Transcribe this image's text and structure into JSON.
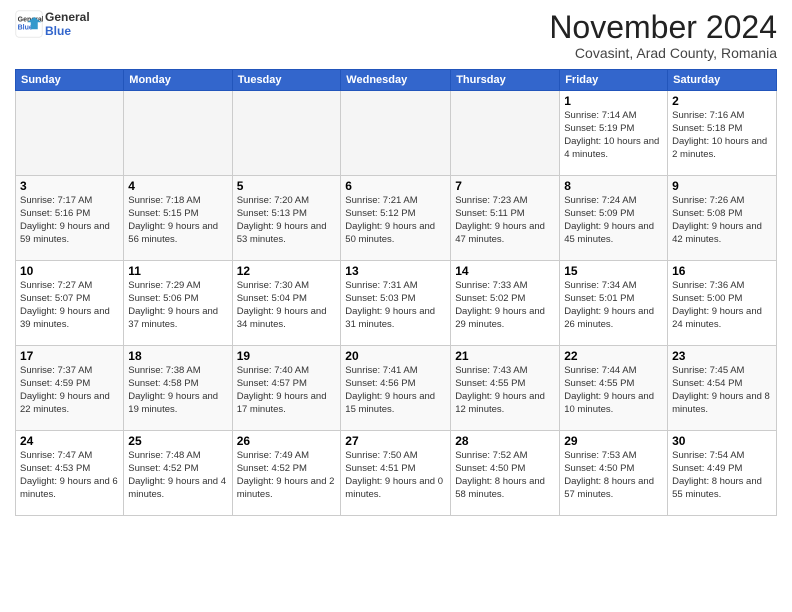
{
  "header": {
    "logo_line1": "General",
    "logo_line2": "Blue",
    "month": "November 2024",
    "location": "Covasint, Arad County, Romania"
  },
  "weekdays": [
    "Sunday",
    "Monday",
    "Tuesday",
    "Wednesday",
    "Thursday",
    "Friday",
    "Saturday"
  ],
  "weeks": [
    [
      {
        "day": "",
        "info": ""
      },
      {
        "day": "",
        "info": ""
      },
      {
        "day": "",
        "info": ""
      },
      {
        "day": "",
        "info": ""
      },
      {
        "day": "",
        "info": ""
      },
      {
        "day": "1",
        "info": "Sunrise: 7:14 AM\nSunset: 5:19 PM\nDaylight: 10 hours and 4 minutes."
      },
      {
        "day": "2",
        "info": "Sunrise: 7:16 AM\nSunset: 5:18 PM\nDaylight: 10 hours and 2 minutes."
      }
    ],
    [
      {
        "day": "3",
        "info": "Sunrise: 7:17 AM\nSunset: 5:16 PM\nDaylight: 9 hours and 59 minutes."
      },
      {
        "day": "4",
        "info": "Sunrise: 7:18 AM\nSunset: 5:15 PM\nDaylight: 9 hours and 56 minutes."
      },
      {
        "day": "5",
        "info": "Sunrise: 7:20 AM\nSunset: 5:13 PM\nDaylight: 9 hours and 53 minutes."
      },
      {
        "day": "6",
        "info": "Sunrise: 7:21 AM\nSunset: 5:12 PM\nDaylight: 9 hours and 50 minutes."
      },
      {
        "day": "7",
        "info": "Sunrise: 7:23 AM\nSunset: 5:11 PM\nDaylight: 9 hours and 47 minutes."
      },
      {
        "day": "8",
        "info": "Sunrise: 7:24 AM\nSunset: 5:09 PM\nDaylight: 9 hours and 45 minutes."
      },
      {
        "day": "9",
        "info": "Sunrise: 7:26 AM\nSunset: 5:08 PM\nDaylight: 9 hours and 42 minutes."
      }
    ],
    [
      {
        "day": "10",
        "info": "Sunrise: 7:27 AM\nSunset: 5:07 PM\nDaylight: 9 hours and 39 minutes."
      },
      {
        "day": "11",
        "info": "Sunrise: 7:29 AM\nSunset: 5:06 PM\nDaylight: 9 hours and 37 minutes."
      },
      {
        "day": "12",
        "info": "Sunrise: 7:30 AM\nSunset: 5:04 PM\nDaylight: 9 hours and 34 minutes."
      },
      {
        "day": "13",
        "info": "Sunrise: 7:31 AM\nSunset: 5:03 PM\nDaylight: 9 hours and 31 minutes."
      },
      {
        "day": "14",
        "info": "Sunrise: 7:33 AM\nSunset: 5:02 PM\nDaylight: 9 hours and 29 minutes."
      },
      {
        "day": "15",
        "info": "Sunrise: 7:34 AM\nSunset: 5:01 PM\nDaylight: 9 hours and 26 minutes."
      },
      {
        "day": "16",
        "info": "Sunrise: 7:36 AM\nSunset: 5:00 PM\nDaylight: 9 hours and 24 minutes."
      }
    ],
    [
      {
        "day": "17",
        "info": "Sunrise: 7:37 AM\nSunset: 4:59 PM\nDaylight: 9 hours and 22 minutes."
      },
      {
        "day": "18",
        "info": "Sunrise: 7:38 AM\nSunset: 4:58 PM\nDaylight: 9 hours and 19 minutes."
      },
      {
        "day": "19",
        "info": "Sunrise: 7:40 AM\nSunset: 4:57 PM\nDaylight: 9 hours and 17 minutes."
      },
      {
        "day": "20",
        "info": "Sunrise: 7:41 AM\nSunset: 4:56 PM\nDaylight: 9 hours and 15 minutes."
      },
      {
        "day": "21",
        "info": "Sunrise: 7:43 AM\nSunset: 4:55 PM\nDaylight: 9 hours and 12 minutes."
      },
      {
        "day": "22",
        "info": "Sunrise: 7:44 AM\nSunset: 4:55 PM\nDaylight: 9 hours and 10 minutes."
      },
      {
        "day": "23",
        "info": "Sunrise: 7:45 AM\nSunset: 4:54 PM\nDaylight: 9 hours and 8 minutes."
      }
    ],
    [
      {
        "day": "24",
        "info": "Sunrise: 7:47 AM\nSunset: 4:53 PM\nDaylight: 9 hours and 6 minutes."
      },
      {
        "day": "25",
        "info": "Sunrise: 7:48 AM\nSunset: 4:52 PM\nDaylight: 9 hours and 4 minutes."
      },
      {
        "day": "26",
        "info": "Sunrise: 7:49 AM\nSunset: 4:52 PM\nDaylight: 9 hours and 2 minutes."
      },
      {
        "day": "27",
        "info": "Sunrise: 7:50 AM\nSunset: 4:51 PM\nDaylight: 9 hours and 0 minutes."
      },
      {
        "day": "28",
        "info": "Sunrise: 7:52 AM\nSunset: 4:50 PM\nDaylight: 8 hours and 58 minutes."
      },
      {
        "day": "29",
        "info": "Sunrise: 7:53 AM\nSunset: 4:50 PM\nDaylight: 8 hours and 57 minutes."
      },
      {
        "day": "30",
        "info": "Sunrise: 7:54 AM\nSunset: 4:49 PM\nDaylight: 8 hours and 55 minutes."
      }
    ]
  ]
}
